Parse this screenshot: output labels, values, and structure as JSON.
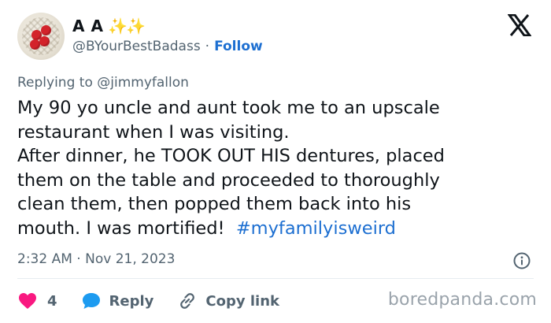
{
  "author": {
    "display_name": "A A",
    "sparkles": "✨✨",
    "handle": "@BYourBestBadass",
    "separator": "·",
    "follow_label": "Follow"
  },
  "icons": {
    "platform": "x-logo-icon",
    "info": "info-icon",
    "like": "heart-icon",
    "reply": "reply-bubble-icon",
    "copy": "link-icon"
  },
  "reply_context": {
    "prefix": "Replying to",
    "mention": "@jimmyfallon"
  },
  "tweet": {
    "lines": [
      "My 90 yo uncle and aunt took me to an upscale",
      "restaurant when I was visiting.",
      "After dinner, he TOOK OUT HIS dentures, placed",
      "them on the table and proceeded to thoroughly",
      "clean them, then popped them back into his",
      "mouth. I was mortified!"
    ],
    "hashtag": "#myfamilyisweird"
  },
  "meta": {
    "time": "2:32 AM",
    "separator": "·",
    "date": "Nov 21, 2023"
  },
  "actions": {
    "like_count": "4",
    "reply_label": "Reply",
    "copy_label": "Copy link"
  },
  "watermark": "boredpanda.com",
  "colors": {
    "link_blue": "#1d6fd1",
    "heart_red": "#f91880",
    "reply_blue": "#1d9bf0",
    "muted": "#536471"
  }
}
